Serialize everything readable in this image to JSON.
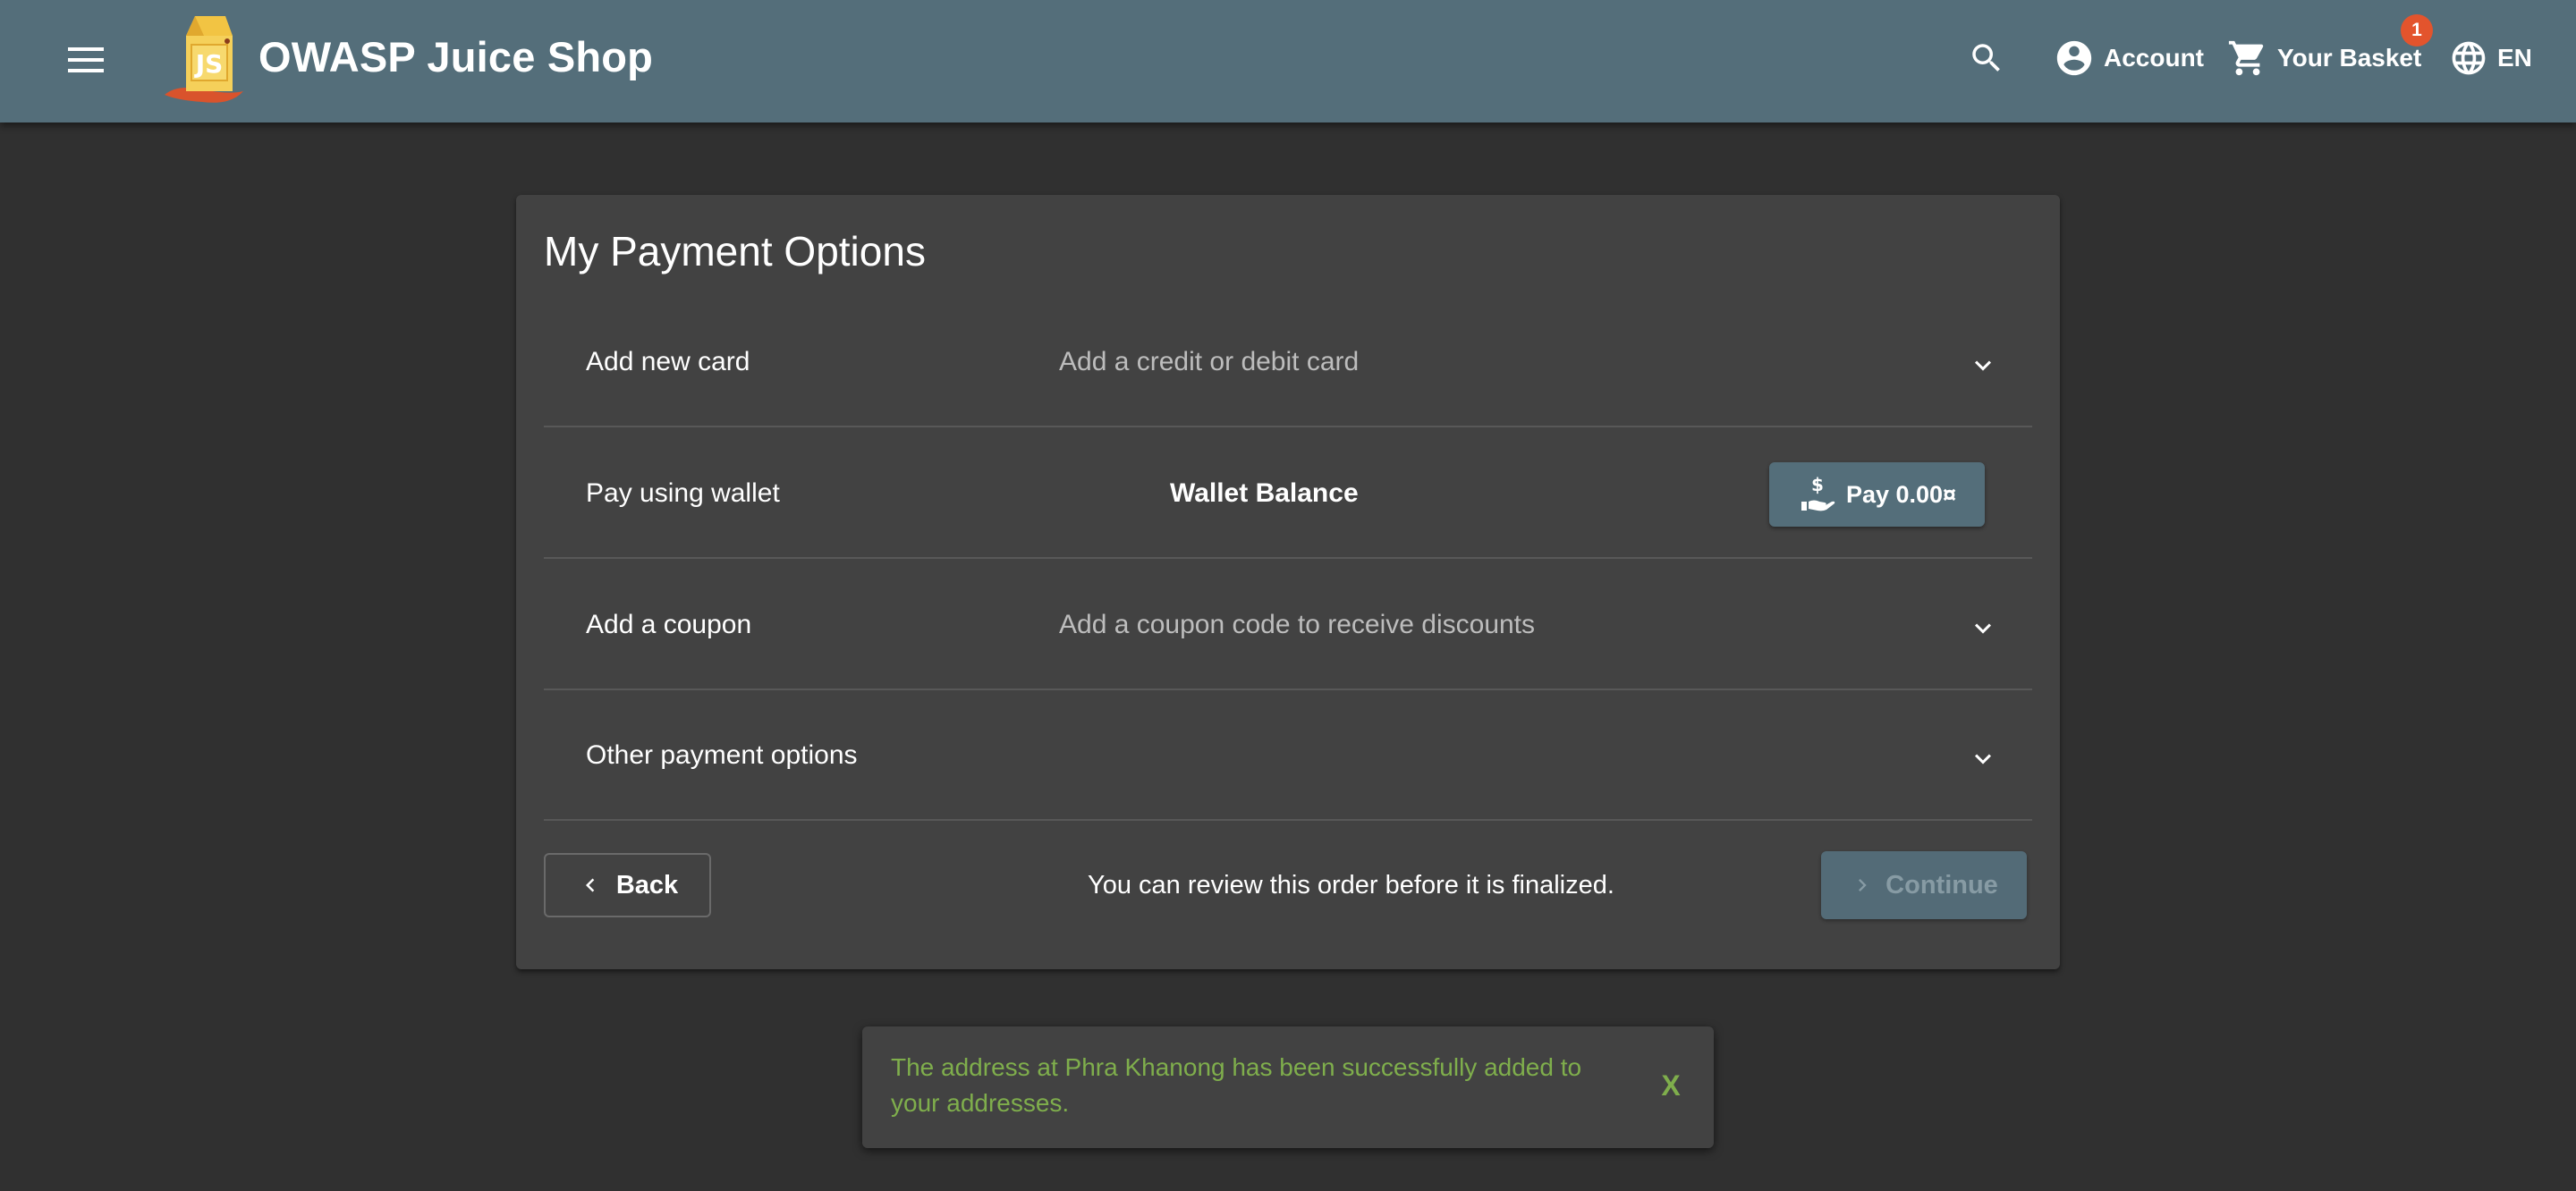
{
  "toolbar": {
    "title": "OWASP Juice Shop",
    "account_label": "Account",
    "basket_label": "Your Basket",
    "basket_count": "1",
    "language_label": "EN",
    "icons": [
      "menu-icon",
      "juice-shop-logo",
      "search-icon",
      "account-circle-icon",
      "shopping-cart-icon",
      "language-icon"
    ],
    "colors": {
      "toolbar_bg": "#546e7a",
      "badge_bg": "#e3542d"
    }
  },
  "payment": {
    "title": "My Payment Options",
    "panels": [
      {
        "title": "Add new card",
        "description": "Add a credit or debit card"
      },
      {
        "title": "Pay using wallet",
        "balance_label": "Wallet Balance",
        "pay_button": "Pay 0.00¤"
      },
      {
        "title": "Add a coupon",
        "description": "Add a coupon code to receive discounts"
      },
      {
        "title": "Other payment options",
        "description": ""
      }
    ],
    "back_label": "Back",
    "review_text": "You can review this order before it is finalized.",
    "continue_label": "Continue"
  },
  "snackbar": {
    "message": "The address at Phra Khanong has been successfully added to your addresses.",
    "close_label": "X",
    "color": "#7fae4c"
  }
}
